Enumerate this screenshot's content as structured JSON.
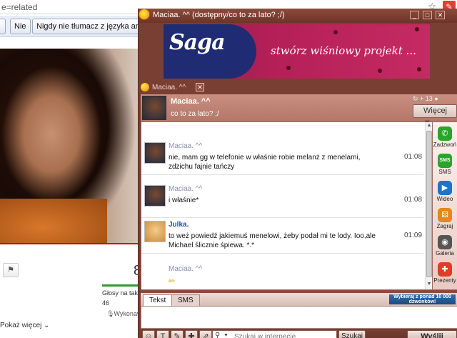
{
  "browser": {
    "address_text": "e=related",
    "star_icon": "star-icon",
    "wrench_icon": "wrench-icon",
    "translate_bar": {
      "button_translate_partial": "",
      "button_no": "Nie",
      "button_never": "Nigdy nie tłumacz z języka angi"
    },
    "views_number": "8",
    "votes_label": "Głosy na tak:",
    "votes_count": "46",
    "performer": "Wykonaw",
    "more_link": "Pokaż więcej",
    "right_line1": "...",
    "right_line2": "..."
  },
  "chat": {
    "window_title": "Maciaa. ^^ (dostępny/co to za lato? ;/)",
    "ad": {
      "logo": "Saga",
      "slogan": "stwórz wiśniowy projekt ..."
    },
    "tab_label": "Maciaa. ^^",
    "contact": {
      "name": "Maciaa. ^^",
      "status": "co to za lato? ;/",
      "header_icons": "↻ + 13 ●",
      "more_button": "Więcej ▼"
    },
    "messages": [
      {
        "author": "Maciaa. ^^",
        "text": "nie, mam gg w telefonie w właśnie robie melanż z menelami, zdzichu fajnie tańczy",
        "time": "01:08"
      },
      {
        "author": "Maciaa. ^^",
        "text": "i właśnie*",
        "time": "01:08"
      },
      {
        "author": "Julka.",
        "text": "to weż powiedź jakiemuś menelowi, żeby podał mi te lody. Ioo,ale Michael ślicznie śpiewa. *.*",
        "time": "01:09"
      },
      {
        "author": "Maciaa. ^^",
        "text": "",
        "time": ""
      }
    ],
    "sidebar": [
      {
        "label": "Zadzwoń",
        "icon": "phone-icon",
        "glyph": "✆",
        "color": "#2aa52a"
      },
      {
        "label": "SMS",
        "icon": "sms-icon",
        "glyph": "SMS",
        "color": "#2aa52a"
      },
      {
        "label": "Wideo",
        "icon": "video-icon",
        "glyph": "▶",
        "color": "#1d74c9"
      },
      {
        "label": "Zagraj",
        "icon": "game-icon",
        "glyph": "⚄",
        "color": "#e7851e"
      },
      {
        "label": "Galeria",
        "icon": "camera-icon",
        "glyph": "◉",
        "color": "#555555"
      },
      {
        "label": "Prezenty",
        "icon": "gift-icon",
        "glyph": "✚",
        "color": "#e23b28"
      }
    ],
    "input_tabs": [
      "Tekst",
      "SMS"
    ],
    "promo": "Wybieraj z ponad 10 000 dzwonków!",
    "message_input_value": "",
    "search_placeholder": "Szukaj w internecie",
    "search_button": "Szukaj",
    "send_button": "Wyślij"
  }
}
